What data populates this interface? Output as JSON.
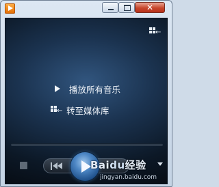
{
  "window": {
    "close_glyph": "✕",
    "icons": [
      "media-player-icon",
      "minimize-icon",
      "maximize-icon",
      "close-icon"
    ]
  },
  "menu": {
    "play_all_label": "播放所有音乐",
    "goto_library_label": "转至媒体库"
  },
  "watermark": {
    "text_left": "Bai",
    "text_du": "du",
    "text_right": "经验",
    "url": "jingyan.baidu.com"
  },
  "colors": {
    "play_accent": "#4c86c4",
    "background": "#0c1826",
    "close_button": "#c8472c"
  }
}
